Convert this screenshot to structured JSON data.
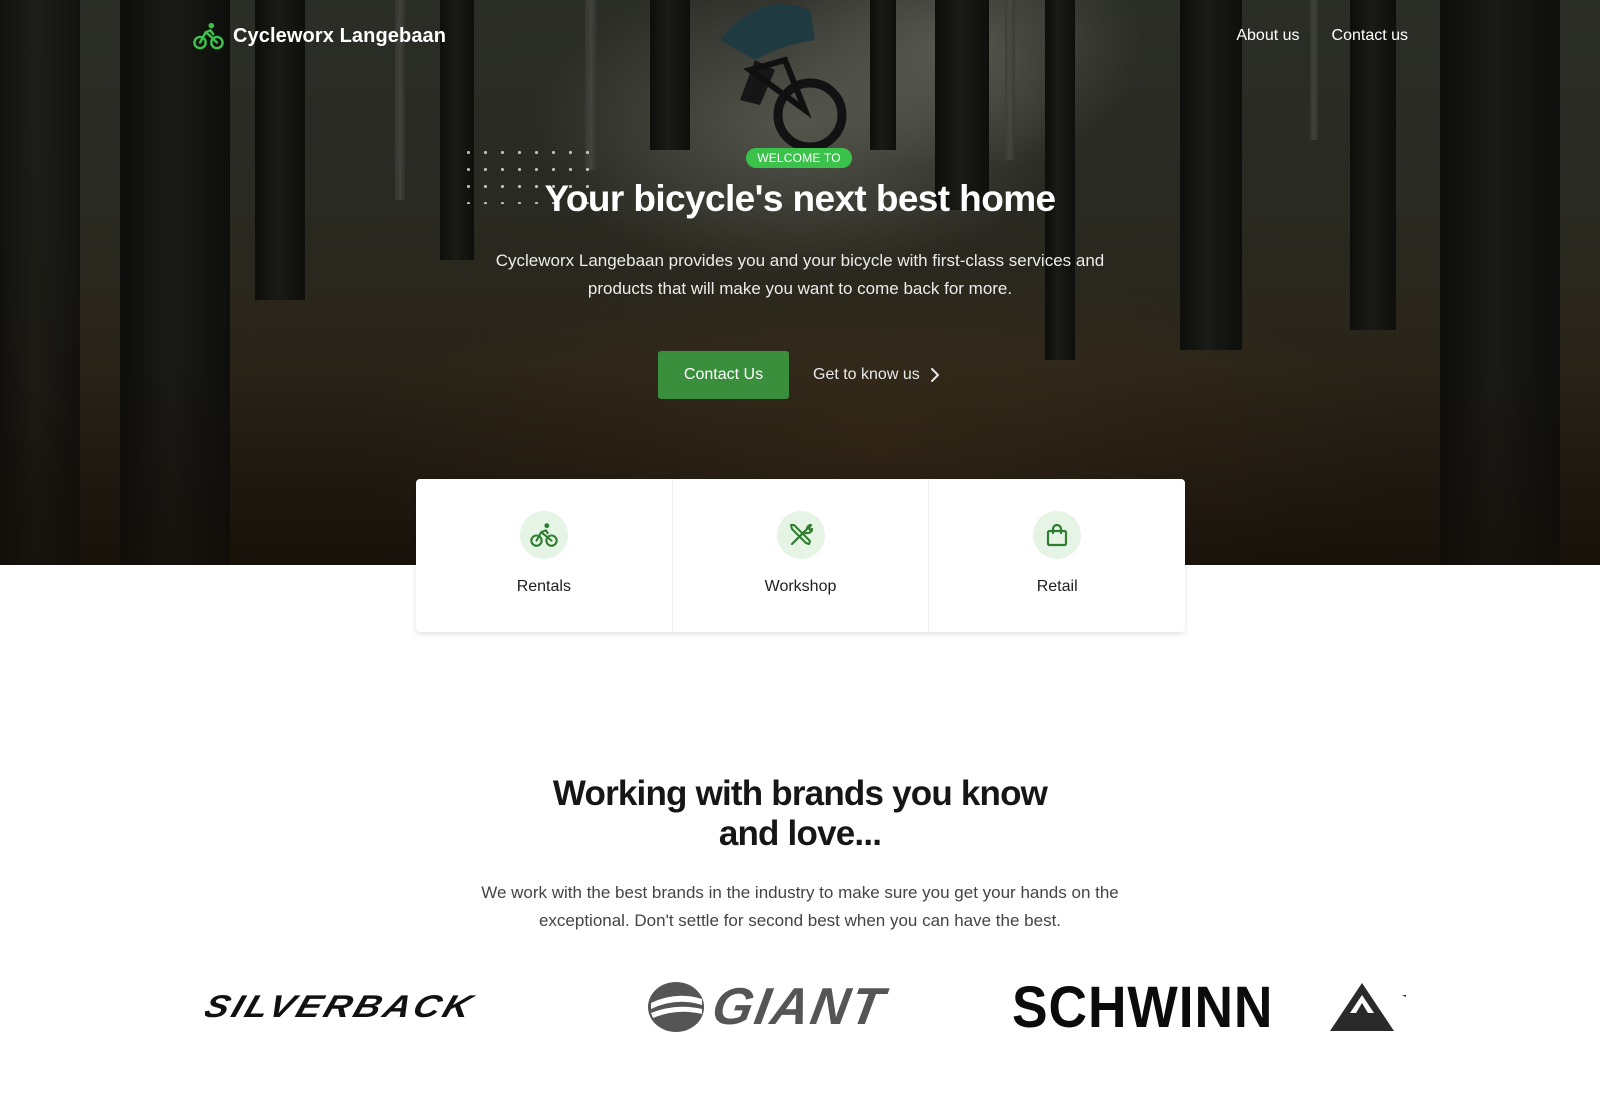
{
  "header": {
    "brand_name": "Cycleworx Langebaan",
    "brand_icon": "cyclist-icon",
    "nav": [
      {
        "label": "About us"
      },
      {
        "label": "Contact us"
      }
    ]
  },
  "hero": {
    "badge": "WELCOME TO",
    "title": "Your bicycle's next best home",
    "description": "Cycleworx Langebaan provides you and your bicycle with first-class services and products that will make you want to come back for more.",
    "primary_button": "Contact Us",
    "secondary_link": "Get to know us"
  },
  "services": [
    {
      "label": "Rentals",
      "icon": "cyclist-icon"
    },
    {
      "label": "Workshop",
      "icon": "tools-icon"
    },
    {
      "label": "Retail",
      "icon": "shopping-bag-icon"
    }
  ],
  "brands": {
    "title_line1": "Working with brands you know",
    "title_line2": "and love...",
    "description": "We work with the best brands in the industry to make sure you get your hands on the exceptional. Don't settle for second best when you can have the best.",
    "logos": [
      "SILVERBACK",
      "GIANT",
      "SCHWINN"
    ]
  },
  "colors": {
    "accent_green": "#3a8f3c",
    "badge_green": "#3ac24a",
    "icon_bg": "#e6f4e6"
  }
}
